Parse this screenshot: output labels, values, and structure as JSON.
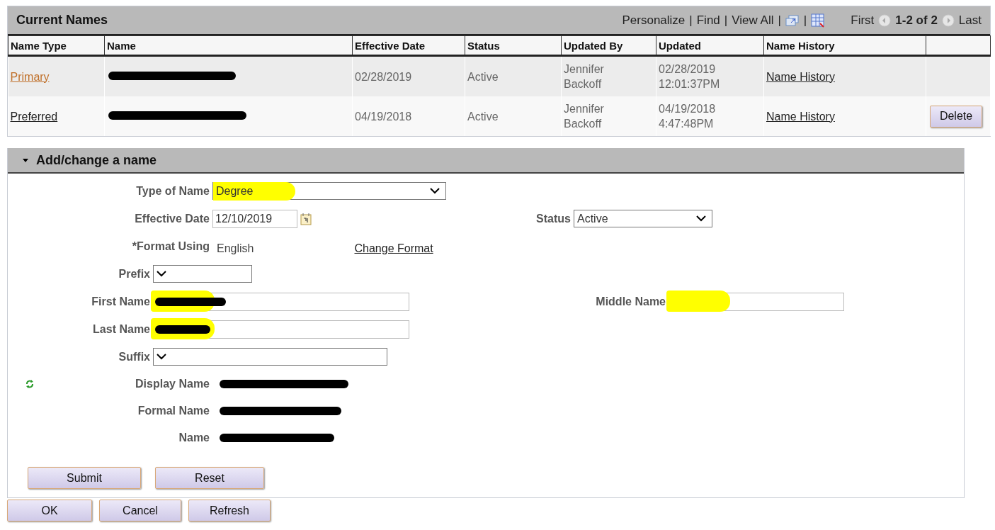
{
  "current_names": {
    "title": "Current Names",
    "toolbar": {
      "personalize": "Personalize",
      "find": "Find",
      "view_all": "View All",
      "separator": "|",
      "first": "First",
      "range": "1-2 of 2",
      "last": "Last"
    },
    "columns": [
      "Name Type",
      "Name",
      "Effective Date",
      "Status",
      "Updated By",
      "Updated",
      "Name History"
    ],
    "rows": [
      {
        "name_type": "Primary",
        "visited": true,
        "name_redacted": true,
        "effective_date": "02/28/2019",
        "status": "Active",
        "updated_by": "Jennifer Backoff",
        "updated": [
          "02/28/2019",
          "12:01:37PM"
        ],
        "history_link": "Name History"
      },
      {
        "name_type": "Preferred",
        "visited": false,
        "name_redacted": true,
        "effective_date": "04/19/2018",
        "status": "Active",
        "updated_by": "Jennifer Backoff",
        "updated": [
          "04/19/2018",
          "4:47:48PM"
        ],
        "history_link": "Name History",
        "delete_button": "Delete"
      }
    ]
  },
  "add_change": {
    "title": "Add/change a name",
    "expanded": true,
    "type_of_name": {
      "label": "Type of Name",
      "value": "Degree",
      "highlighted": true
    },
    "effective_date": {
      "label": "Effective Date",
      "value": "12/10/2019"
    },
    "status": {
      "label": "Status",
      "value": "Active"
    },
    "format_using": {
      "label": "*Format Using",
      "value": "English",
      "link": "Change Format"
    },
    "prefix": {
      "label": "Prefix"
    },
    "first_name": {
      "label": "First Name",
      "redacted": true,
      "highlighted": true
    },
    "middle_name": {
      "label": "Middle Name",
      "highlighted": true
    },
    "last_name": {
      "label": "Last Name",
      "redacted": true,
      "highlighted": true
    },
    "suffix": {
      "label": "Suffix"
    },
    "display_name": {
      "label": "Display Name",
      "redacted": true
    },
    "formal_name": {
      "label": "Formal Name",
      "redacted": true
    },
    "name": {
      "label": "Name",
      "redacted": true
    },
    "buttons": [
      "Submit",
      "Reset"
    ]
  },
  "page_buttons": [
    {
      "label": "OK",
      "disabled": false
    },
    {
      "label": "Cancel",
      "disabled": false
    },
    {
      "label": "Refresh",
      "disabled": false
    }
  ]
}
